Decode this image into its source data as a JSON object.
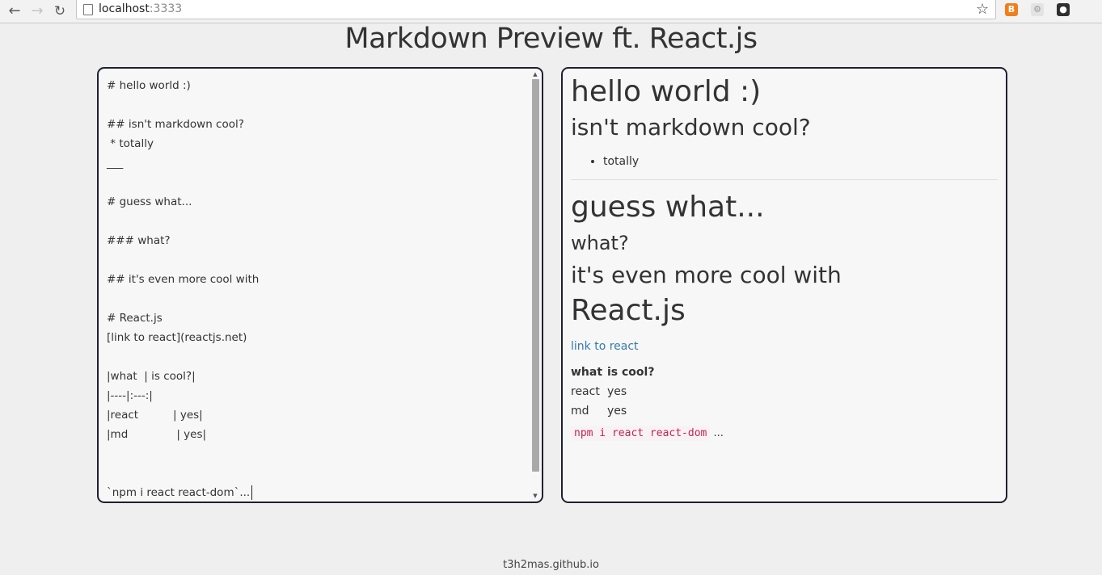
{
  "browser": {
    "url_host": "localhost",
    "url_port": ":3333",
    "extension_1_label": "B"
  },
  "page": {
    "title": "Markdown Preview ft. React.js",
    "footer": "t3h2mas.github.io"
  },
  "editor": {
    "lines": [
      "# hello world :)",
      "",
      "## isn't markdown cool?",
      " * totally",
      "___",
      "",
      "# guess what...",
      "",
      "### what?",
      "",
      "## it's even more cool with",
      "",
      "# React.js",
      "[link to react](reactjs.net)",
      "",
      "|what  | is cool?|",
      "|----|:---:|",
      "|react          | yes|",
      "|md              | yes|",
      "",
      "",
      "`npm i react react-dom`..."
    ]
  },
  "preview": {
    "h1_hello": "hello world :)",
    "h2_markdown": "isn't markdown cool?",
    "list_item": "totally",
    "h1_guess": "guess what...",
    "h3_what": "what?",
    "h2_cool": "it's even more cool with",
    "h1_react": "React.js",
    "link_text": "link to react",
    "table": {
      "headers": [
        "what",
        "is cool?"
      ],
      "rows": [
        [
          "react",
          "yes"
        ],
        [
          "md",
          "yes"
        ]
      ]
    },
    "code_text": "npm i react react-dom",
    "code_suffix": "..."
  }
}
